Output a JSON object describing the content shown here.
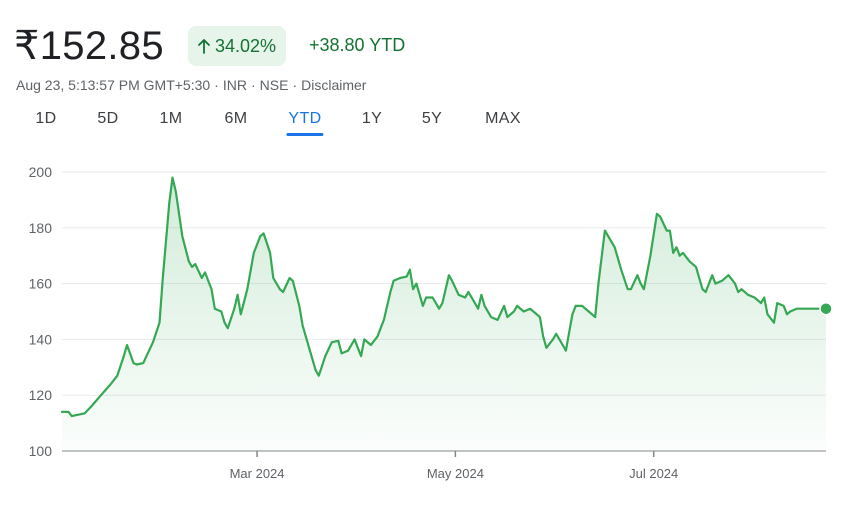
{
  "header": {
    "price": "₹152.85",
    "change_percent": "34.02%",
    "change_icon": "arrow-up-icon",
    "change_value": "+38.80 YTD",
    "meta_time": "Aug 23, 5:13:57 PM GMT+5:30",
    "meta_currency": "INR",
    "meta_exchange": "NSE",
    "meta_disclaimer": "Disclaimer",
    "positive_color": "#137333",
    "chip_bg": "#e6f4ea"
  },
  "ranges": {
    "tabs": [
      "1D",
      "5D",
      "1M",
      "6M",
      "YTD",
      "1Y",
      "5Y",
      "MAX"
    ],
    "active": "YTD",
    "active_color": "#1a73e8"
  },
  "chart_data": {
    "type": "area",
    "line_color": "#34a853",
    "ylim": [
      100,
      200
    ],
    "yticks": [
      100,
      120,
      140,
      160,
      180,
      200
    ],
    "xlim": [
      "2024-01-01",
      "2024-08-23"
    ],
    "xticks": [
      {
        "label": "Mar 2024",
        "date": "2024-03-01"
      },
      {
        "label": "May 2024",
        "date": "2024-05-01"
      },
      {
        "label": "Jul 2024",
        "date": "2024-07-01"
      }
    ],
    "grid": true,
    "series": [
      {
        "points": [
          [
            "2024-01-01",
            114
          ],
          [
            "2024-01-03",
            114
          ],
          [
            "2024-01-04",
            112.5
          ],
          [
            "2024-01-06",
            113
          ],
          [
            "2024-01-08",
            113.5
          ],
          [
            "2024-01-10",
            116
          ],
          [
            "2024-01-13",
            120
          ],
          [
            "2024-01-16",
            124
          ],
          [
            "2024-01-18",
            127
          ],
          [
            "2024-01-20",
            134
          ],
          [
            "2024-01-21",
            138
          ],
          [
            "2024-01-23",
            131.5
          ],
          [
            "2024-01-24",
            131
          ],
          [
            "2024-01-26",
            131.5
          ],
          [
            "2024-01-27",
            134
          ],
          [
            "2024-01-29",
            139
          ],
          [
            "2024-01-31",
            146
          ],
          [
            "2024-02-01",
            162
          ],
          [
            "2024-02-03",
            189
          ],
          [
            "2024-02-04",
            198
          ],
          [
            "2024-02-05",
            193
          ],
          [
            "2024-02-07",
            177
          ],
          [
            "2024-02-09",
            168
          ],
          [
            "2024-02-10",
            166
          ],
          [
            "2024-02-11",
            167
          ],
          [
            "2024-02-13",
            162
          ],
          [
            "2024-02-14",
            164
          ],
          [
            "2024-02-16",
            158
          ],
          [
            "2024-02-17",
            151
          ],
          [
            "2024-02-19",
            150
          ],
          [
            "2024-02-20",
            146
          ],
          [
            "2024-02-21",
            144
          ],
          [
            "2024-02-23",
            151
          ],
          [
            "2024-02-24",
            156
          ],
          [
            "2024-02-25",
            149
          ],
          [
            "2024-02-27",
            158
          ],
          [
            "2024-02-29",
            171
          ],
          [
            "2024-03-02",
            177
          ],
          [
            "2024-03-03",
            178
          ],
          [
            "2024-03-05",
            171
          ],
          [
            "2024-03-06",
            162
          ],
          [
            "2024-03-08",
            158
          ],
          [
            "2024-03-09",
            157
          ],
          [
            "2024-03-11",
            162
          ],
          [
            "2024-03-12",
            161
          ],
          [
            "2024-03-14",
            152
          ],
          [
            "2024-03-15",
            145
          ],
          [
            "2024-03-17",
            137
          ],
          [
            "2024-03-19",
            129
          ],
          [
            "2024-03-20",
            127
          ],
          [
            "2024-03-22",
            134
          ],
          [
            "2024-03-24",
            139
          ],
          [
            "2024-03-26",
            139.5
          ],
          [
            "2024-03-27",
            135
          ],
          [
            "2024-03-29",
            136
          ],
          [
            "2024-03-31",
            140
          ],
          [
            "2024-04-01",
            137
          ],
          [
            "2024-04-02",
            134
          ],
          [
            "2024-04-03",
            140
          ],
          [
            "2024-04-05",
            138
          ],
          [
            "2024-04-07",
            141
          ],
          [
            "2024-04-09",
            147
          ],
          [
            "2024-04-11",
            157
          ],
          [
            "2024-04-12",
            161
          ],
          [
            "2024-04-14",
            162
          ],
          [
            "2024-04-16",
            162.5
          ],
          [
            "2024-04-17",
            165
          ],
          [
            "2024-04-18",
            158
          ],
          [
            "2024-04-19",
            160
          ],
          [
            "2024-04-21",
            152
          ],
          [
            "2024-04-22",
            155
          ],
          [
            "2024-04-24",
            155
          ],
          [
            "2024-04-26",
            151
          ],
          [
            "2024-04-27",
            153
          ],
          [
            "2024-04-29",
            163
          ],
          [
            "2024-04-30",
            161
          ],
          [
            "2024-05-02",
            156
          ],
          [
            "2024-05-04",
            155
          ],
          [
            "2024-05-05",
            157
          ],
          [
            "2024-05-07",
            153
          ],
          [
            "2024-05-08",
            151
          ],
          [
            "2024-05-09",
            156
          ],
          [
            "2024-05-10",
            152
          ],
          [
            "2024-05-12",
            148
          ],
          [
            "2024-05-14",
            147
          ],
          [
            "2024-05-16",
            152
          ],
          [
            "2024-05-17",
            148
          ],
          [
            "2024-05-19",
            150
          ],
          [
            "2024-05-20",
            152
          ],
          [
            "2024-05-22",
            150
          ],
          [
            "2024-05-24",
            151
          ],
          [
            "2024-05-25",
            150
          ],
          [
            "2024-05-27",
            148
          ],
          [
            "2024-05-28",
            141
          ],
          [
            "2024-05-29",
            137
          ],
          [
            "2024-05-31",
            140
          ],
          [
            "2024-06-01",
            142
          ],
          [
            "2024-06-03",
            138
          ],
          [
            "2024-06-04",
            136
          ],
          [
            "2024-06-06",
            149
          ],
          [
            "2024-06-07",
            152
          ],
          [
            "2024-06-09",
            152
          ],
          [
            "2024-06-11",
            150
          ],
          [
            "2024-06-13",
            148
          ],
          [
            "2024-06-14",
            160
          ],
          [
            "2024-06-16",
            179
          ],
          [
            "2024-06-17",
            177
          ],
          [
            "2024-06-19",
            173
          ],
          [
            "2024-06-21",
            165
          ],
          [
            "2024-06-23",
            158
          ],
          [
            "2024-06-24",
            158
          ],
          [
            "2024-06-26",
            163
          ],
          [
            "2024-06-27",
            160
          ],
          [
            "2024-06-28",
            158
          ],
          [
            "2024-06-30",
            170
          ],
          [
            "2024-07-02",
            185
          ],
          [
            "2024-07-03",
            184
          ],
          [
            "2024-07-05",
            179
          ],
          [
            "2024-07-06",
            179
          ],
          [
            "2024-07-07",
            171
          ],
          [
            "2024-07-08",
            173
          ],
          [
            "2024-07-09",
            170
          ],
          [
            "2024-07-10",
            171
          ],
          [
            "2024-07-12",
            168
          ],
          [
            "2024-07-14",
            166
          ],
          [
            "2024-07-16",
            158
          ],
          [
            "2024-07-17",
            157
          ],
          [
            "2024-07-19",
            163
          ],
          [
            "2024-07-20",
            160
          ],
          [
            "2024-07-22",
            161
          ],
          [
            "2024-07-24",
            163
          ],
          [
            "2024-07-26",
            160
          ],
          [
            "2024-07-27",
            157
          ],
          [
            "2024-07-28",
            158
          ],
          [
            "2024-07-30",
            156
          ],
          [
            "2024-08-01",
            155
          ],
          [
            "2024-08-03",
            153
          ],
          [
            "2024-08-04",
            155
          ],
          [
            "2024-08-05",
            149
          ],
          [
            "2024-08-07",
            146
          ],
          [
            "2024-08-08",
            153
          ],
          [
            "2024-08-10",
            152
          ],
          [
            "2024-08-11",
            149
          ],
          [
            "2024-08-12",
            150
          ],
          [
            "2024-08-14",
            151
          ],
          [
            "2024-08-23",
            151
          ]
        ]
      }
    ]
  }
}
